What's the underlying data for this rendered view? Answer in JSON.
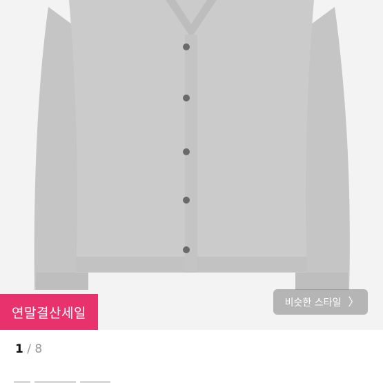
{
  "product": {
    "image_alt": "light gray v-neck button cardigan",
    "colors": {
      "background": "#f3f3f3",
      "knit": "#c9c9c9",
      "button": "#6a6a6a"
    }
  },
  "sale_badge": {
    "label": "연말결산세일",
    "color": "#e8326e"
  },
  "similar_style": {
    "label": "비슷한 스타일",
    "icon": "chevron-right-icon"
  },
  "pager": {
    "current": "1",
    "separator": "/",
    "total": "8"
  }
}
